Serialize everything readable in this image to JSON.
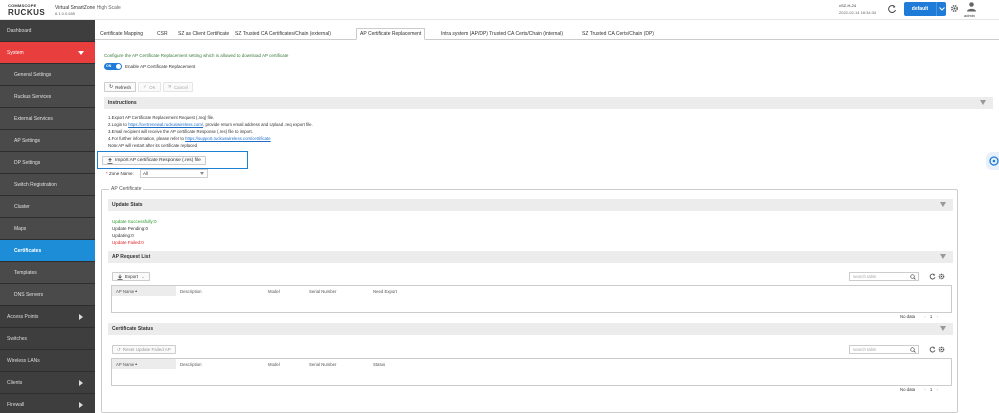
{
  "header": {
    "brand_top": "COMMSCOPE",
    "brand_main": "RUCKUS",
    "product": "Virtual SmartZone",
    "edition": "High Scale",
    "version": "6.1.0.0.655",
    "host": "vSZ-H-24",
    "datetime": "2022-02-14 18:34:34",
    "domain": "default",
    "user": "admin"
  },
  "sidebar": {
    "items": [
      {
        "label": "Dashboard",
        "type": "top"
      },
      {
        "label": "System",
        "type": "active-parent"
      },
      {
        "label": "General Settings",
        "type": "sub"
      },
      {
        "label": "Ruckus Services",
        "type": "sub"
      },
      {
        "label": "External Services",
        "type": "sub"
      },
      {
        "label": "AP Settings",
        "type": "sub"
      },
      {
        "label": "DP Settings",
        "type": "sub"
      },
      {
        "label": "Switch Registration",
        "type": "sub"
      },
      {
        "label": "Cluster",
        "type": "sub"
      },
      {
        "label": "Maps",
        "type": "sub"
      },
      {
        "label": "Certificates",
        "type": "sub-active"
      },
      {
        "label": "Templates",
        "type": "sub"
      },
      {
        "label": "DNS Servers",
        "type": "sub"
      },
      {
        "label": "Access Points",
        "type": "top-arrow"
      },
      {
        "label": "Switches",
        "type": "top"
      },
      {
        "label": "Wireless LANs",
        "type": "top"
      },
      {
        "label": "Clients",
        "type": "top-arrow"
      },
      {
        "label": "Firewall",
        "type": "top-arrow"
      }
    ]
  },
  "tabs": [
    "Certificate Mapping",
    "CSR",
    "SZ as Client Certificate",
    "SZ Trusted CA Certificates/Chain (external)",
    "AP Certificate Replacement",
    "Intra system (AP/DP) Trusted CA Certs/Chain (internal)",
    "SZ Trusted CA Certs/Chain (DP)"
  ],
  "content": {
    "description": "Configure the AP Certificate Replacement setting which is allowed to download AP certificate",
    "toggle_on": "ON",
    "toggle_label": "Enable AP Certificate Replacement",
    "refresh": "Refresh",
    "ok": "OK",
    "cancel": "Cancel",
    "instructions_title": "Instructions",
    "instr_1": "1.Export AP Certificate Replacement Request (.req) file.",
    "instr_2a": "2.Login to ",
    "instr_2_link": "https://certrenewal.ruckuswireless.com/",
    "instr_2b": ", provide return email address and Upload .req export file.",
    "instr_3": "3.Email recipient will receive the AP certificate Response (.res) file to import.",
    "instr_4a": "4.For further information, please refer to ",
    "instr_4_link": "https://support.ruckuswireless.com/certificate",
    "instr_5": "Note:AP will restart after its certificate replaced",
    "import_btn": "Import AP certificate Response (.res) file",
    "zone_req": "*",
    "zone_label": "Zone Name:",
    "zone_value": "All",
    "ap_cert_legend": "AP Certificate",
    "update_stats_title": "Update Stats",
    "stat_success": "Update Successfully:0",
    "stat_pending": "Update Pending:0",
    "stat_updating": "Updating:0",
    "stat_failed": "Update Failed:0",
    "ap_request_title": "AP Request List",
    "export": "Export",
    "search_placeholder": "search table",
    "req_cols": [
      "AP Name",
      "Description",
      "Model",
      "Serial Number",
      "Need Export"
    ],
    "no_data": "No data",
    "page_num": "1",
    "cert_status_title": "Certificate Status",
    "reset_btn": "Reset Update Failed AP",
    "status_cols": [
      "AP Name",
      "Description",
      "Model",
      "Serial Number",
      "Status"
    ]
  },
  "colors": {
    "accent_blue": "#1e7bd8",
    "active_red": "#e83e3e",
    "success_green": "#2a9a2a",
    "failed_red": "#e02020"
  }
}
